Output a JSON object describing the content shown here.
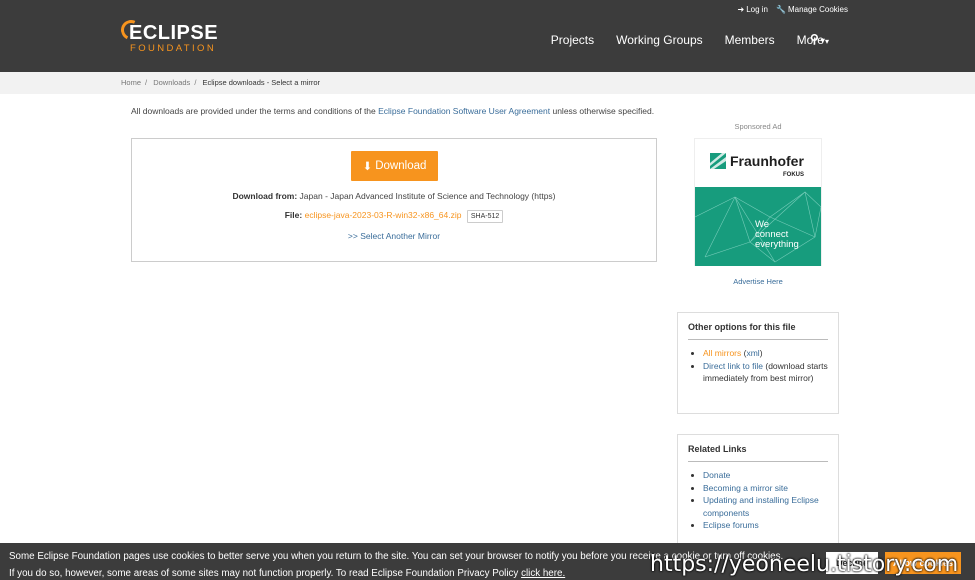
{
  "header": {
    "login": "Log in",
    "manage_cookies": "Manage Cookies",
    "logo_top": "ECLIPSE",
    "logo_bottom": "FOUNDATION",
    "nav": [
      "Projects",
      "Working Groups",
      "Members",
      "More"
    ]
  },
  "breadcrumb": [
    "Home",
    "Downloads",
    "Eclipse downloads - Select a mirror"
  ],
  "main": {
    "intro_before": "All downloads are provided under the terms and conditions of the ",
    "intro_link": "Eclipse Foundation Software User Agreement",
    "intro_after": " unless otherwise specified.",
    "download_button": "Download",
    "download_from_label": "Download from:",
    "download_from_value": "Japan - Japan Advanced Institute of Science and Technology (https)",
    "file_label": "File:",
    "file_name": "eclipse-java-2023-03-R-win32-x86_64.zip",
    "sha_button": "SHA-512",
    "select_mirror": ">> Select Another Mirror"
  },
  "sidebar": {
    "sponsored": "Sponsored Ad",
    "ad_name": "Fraunhofer",
    "ad_sub": "FOKUS",
    "ad_tagline": [
      "We",
      "connect",
      "everything"
    ],
    "advertise": "Advertise Here",
    "other_title": "Other options for this file",
    "all_mirrors": "All mirrors",
    "xml_open": " (",
    "xml": "xml",
    "xml_close": ")",
    "direct_link": "Direct link to file",
    "direct_note": " (download starts immediately from best mirror)",
    "related_title": "Related Links",
    "related": [
      "Donate",
      "Becoming a mirror site",
      "Updating and installing Eclipse components",
      "Eclipse forums"
    ]
  },
  "cookie": {
    "line1": "Some Eclipse Foundation pages use cookies to better serve you when you return to the site. You can set your browser to notify you before you receive a cookie or turn off cookies.",
    "line2": "If you do so, however, some areas of some sites may not function properly. To read Eclipse Foundation Privacy Policy ",
    "click_here": "click here.",
    "decline": "Decline",
    "accept": "Allow cookies"
  },
  "watermark": "https://yeoneelu.tistory.com",
  "colors": {
    "accent": "#f7941e",
    "header_bg": "#3c3c3c",
    "link": "#3a6d9a",
    "ad_green": "#179c7d"
  }
}
